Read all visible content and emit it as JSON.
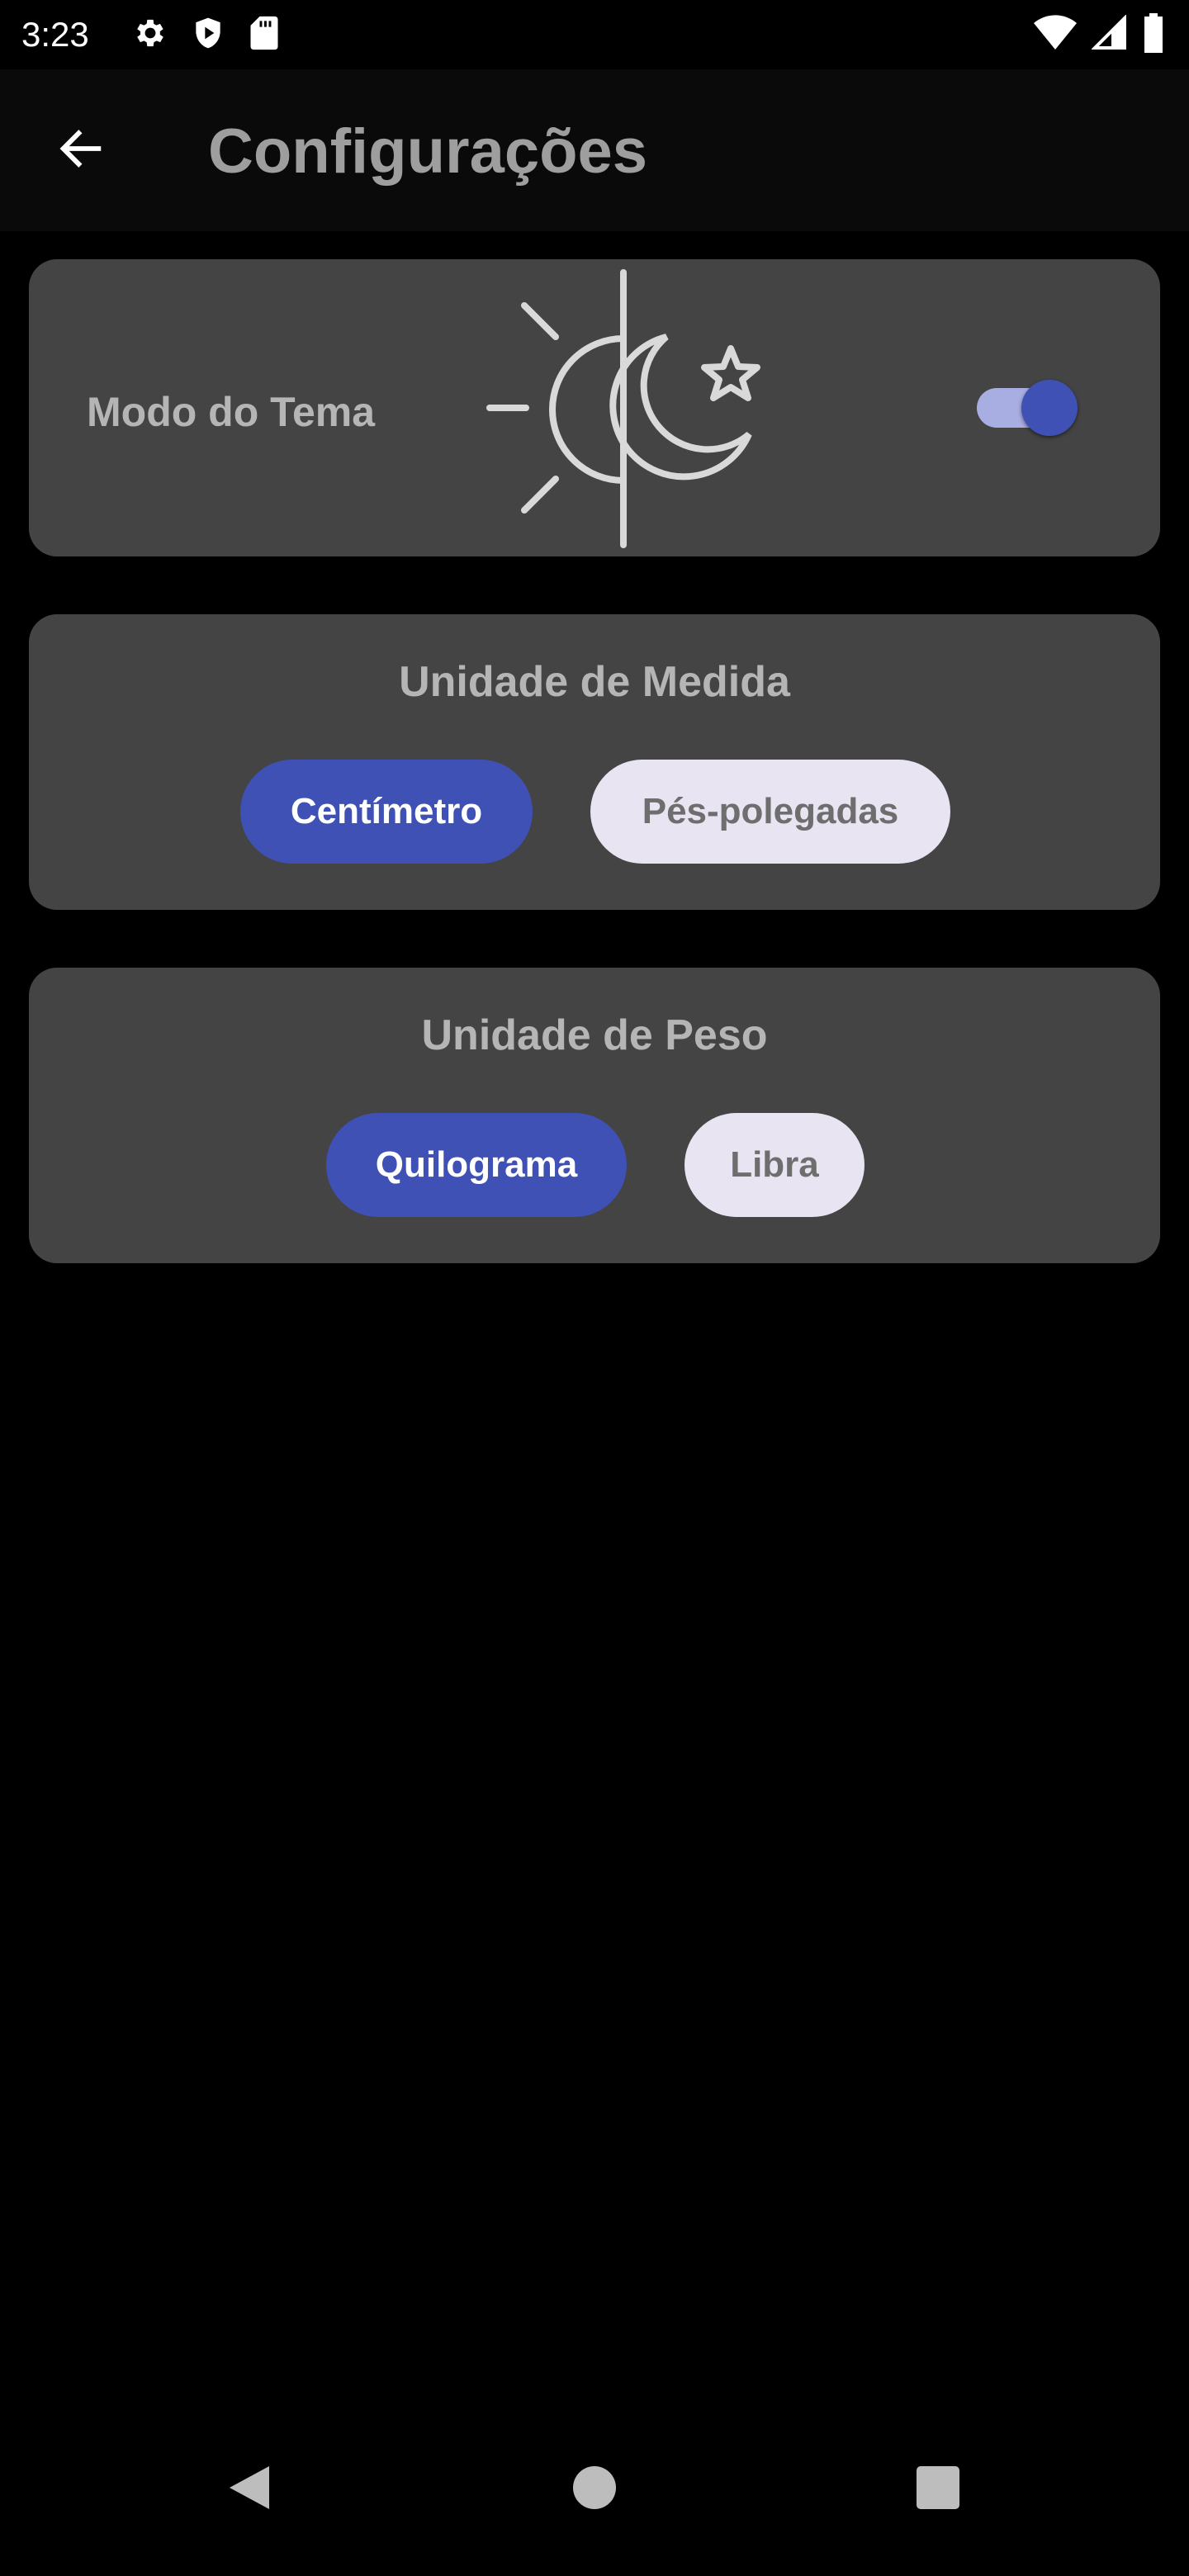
{
  "status_bar": {
    "time": "3:23",
    "left_icons": [
      "settings-icon",
      "shield-icon",
      "sd-card-icon"
    ],
    "right_icons": [
      "wifi-icon",
      "signal-icon",
      "battery-icon"
    ]
  },
  "app_bar": {
    "back_icon": "arrow-left-icon",
    "title": "Configurações"
  },
  "theme_card": {
    "label": "Modo do Tema",
    "illustration_icon": "sun-moon-icon",
    "toggle_on": true,
    "accent_color": "#3f51b5"
  },
  "measure_card": {
    "title": "Unidade de Medida",
    "options": [
      "Centímetro",
      "Pés-polegadas"
    ],
    "selected": "Centímetro"
  },
  "weight_card": {
    "title": "Unidade de Peso",
    "options": [
      "Quilograma",
      "Libra"
    ],
    "selected": "Quilograma"
  },
  "nav_bar": {
    "icons": [
      "back-triangle-icon",
      "home-circle-icon",
      "recents-square-icon"
    ]
  },
  "colors": {
    "background": "#000000",
    "card": "#444444",
    "accent": "#3f51b5",
    "chip_unselected": "#e8e4f2",
    "muted_text": "#b5b5b5"
  }
}
